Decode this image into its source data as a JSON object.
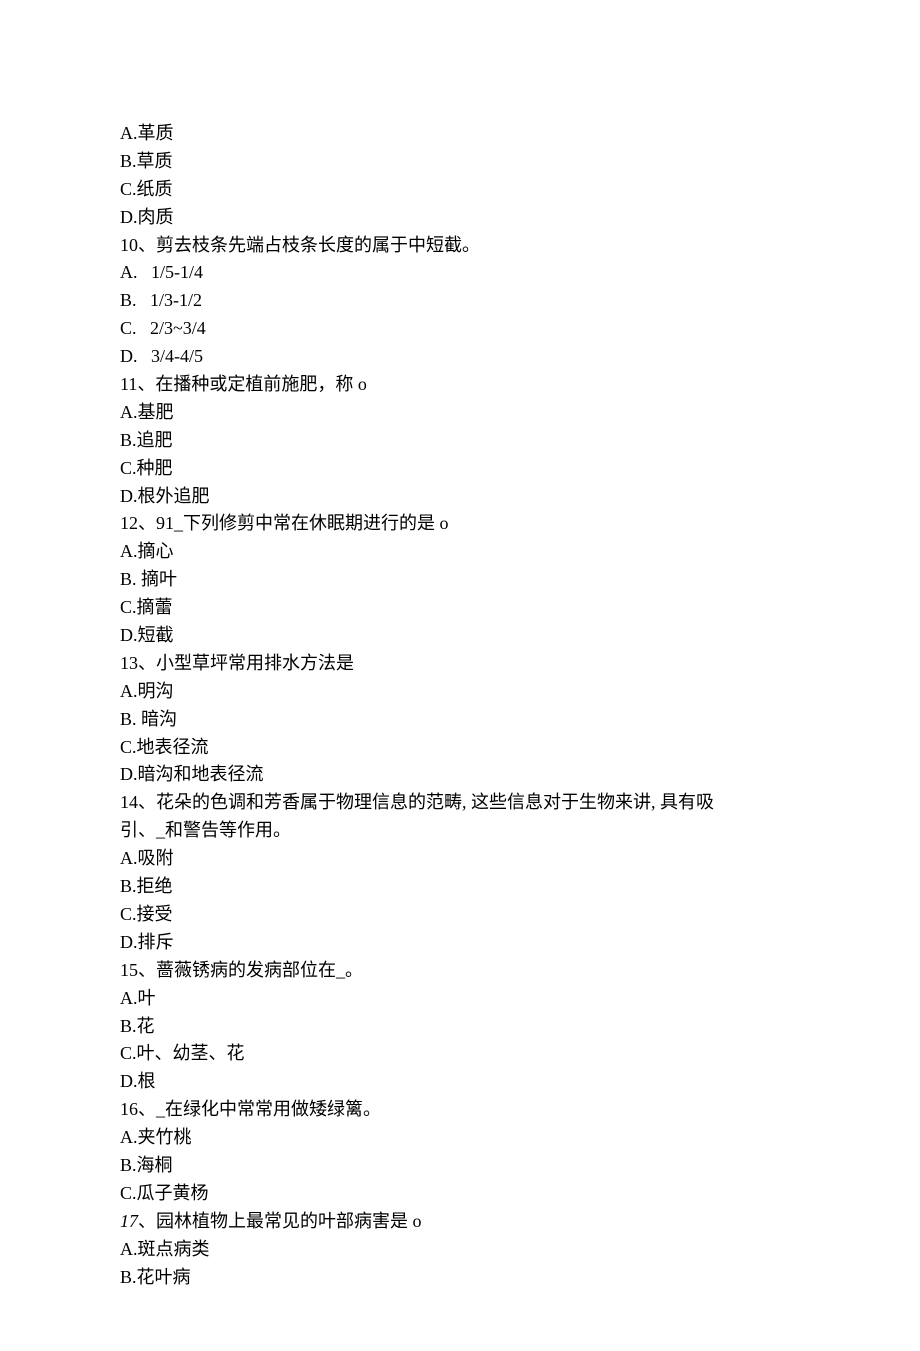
{
  "content": {
    "q9_opts": {
      "A": "A.革质",
      "B": "B.草质",
      "C": "C.纸质",
      "D": "D.肉质"
    },
    "q10": {
      "stem": "10、剪去枝条先端占枝条长度的属于中短截。",
      "A": "A.   1/5-1/4",
      "B": "B.   1/3-1/2",
      "C": "C.   2/3~3/4",
      "D": "D.   3/4-4/5"
    },
    "q11": {
      "stem": "11、在播种或定植前施肥，称 o",
      "A": "A.基肥",
      "B": "B.追肥",
      "C": "C.种肥",
      "D": "D.根外追肥"
    },
    "q12": {
      "stem": "12、91_下列修剪中常在休眠期进行的是 o",
      "A": "A.摘心",
      "B": "B. 摘叶",
      "C": "C.摘蕾",
      "D": "D.短截"
    },
    "q13": {
      "stem": "13、小型草坪常用排水方法是",
      "A": "A.明沟",
      "B": "B. 暗沟",
      "C": "C.地表径流",
      "D": "D.暗沟和地表径流"
    },
    "q14": {
      "stem_line1": "14、花朵的色调和芳香属于物理信息的范畴, 这些信息对于生物来讲, 具有吸",
      "stem_line2": "引、_和警告等作用。",
      "A": "A.吸附",
      "B": "B.拒绝",
      "C": "C.接受",
      "D": "D.排斥"
    },
    "q15": {
      "stem": "15、蔷薇锈病的发病部位在_。",
      "A": "A.叶",
      "B": "B.花",
      "C": "C.叶、幼茎、花",
      "D": "D.根"
    },
    "q16": {
      "stem": "16、_在绿化中常常用做矮绿篱。",
      "A": "A.夹竹桃",
      "B": "B.海桐",
      "C": "C.瓜子黄杨"
    },
    "q17": {
      "num": "17",
      "stem_rest": "、园林植物上最常见的叶部病害是 o",
      "A": "A.斑点病类",
      "B": "B.花叶病"
    }
  }
}
